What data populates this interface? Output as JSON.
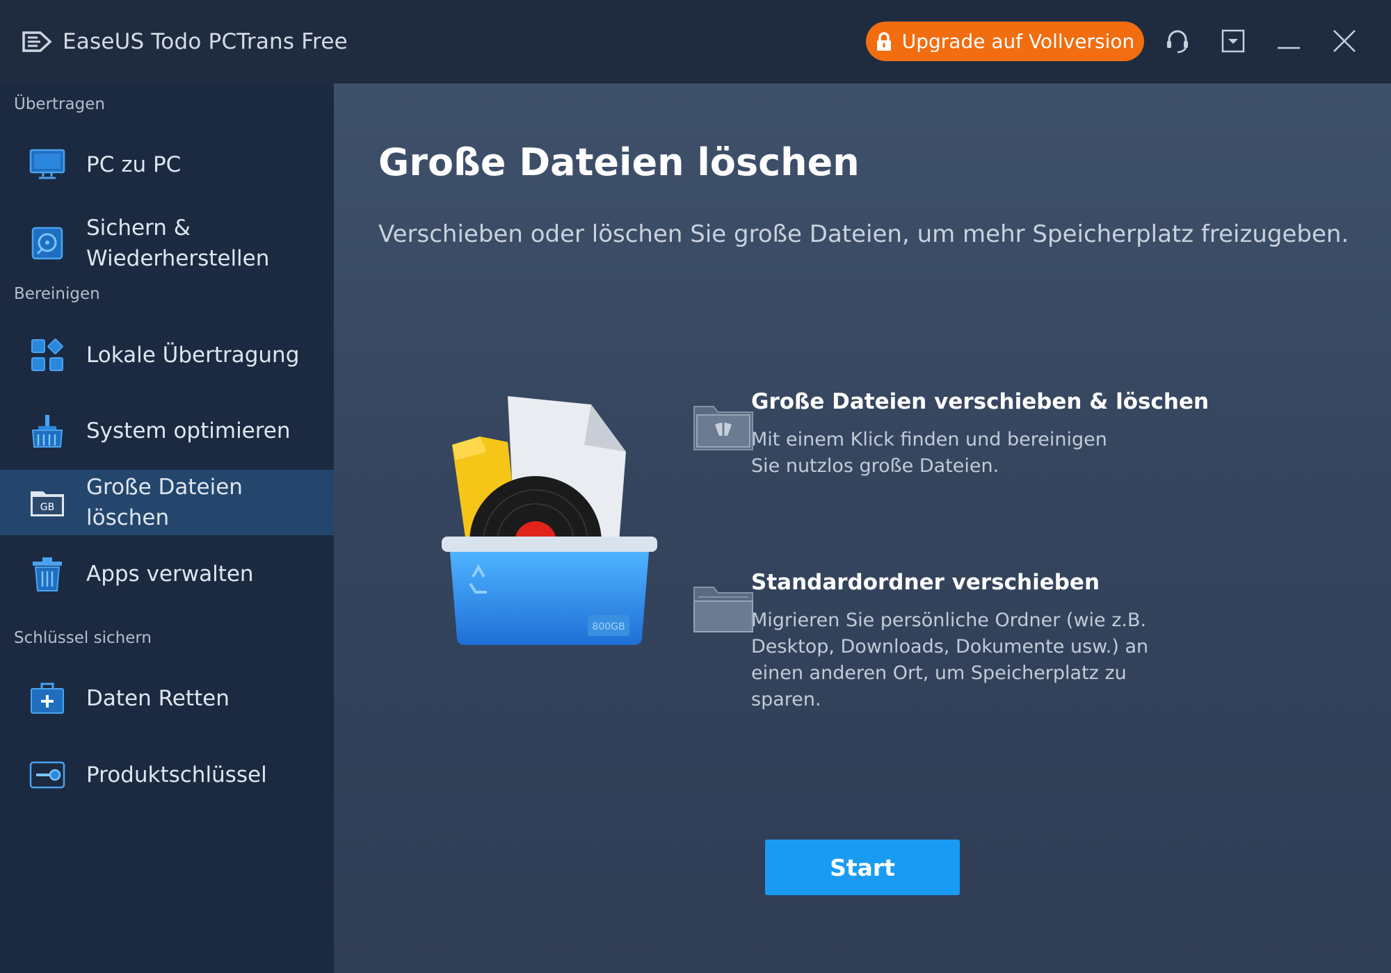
{
  "app": {
    "title": "EaseUS Todo PCTrans Free",
    "upgrade_label": "Upgrade auf Vollversion"
  },
  "sidebar": {
    "sections": [
      {
        "label": "Übertragen"
      },
      {
        "label": "Bereinigen"
      },
      {
        "label": "Schlüssel sichern"
      }
    ],
    "items": [
      {
        "label": "PC zu PC",
        "icon": "monitor-icon"
      },
      {
        "label": "Sichern & Wiederherstellen",
        "icon": "backup-disk-icon"
      },
      {
        "label": "Lokale Übertragung",
        "icon": "apps-grid-icon"
      },
      {
        "label": "System optimieren",
        "icon": "broom-icon"
      },
      {
        "label": "Große Dateien löschen",
        "icon": "gb-folder-icon",
        "active": true
      },
      {
        "label": "Apps verwalten",
        "icon": "trash-icon"
      },
      {
        "label": "Daten Retten",
        "icon": "first-aid-icon"
      },
      {
        "label": "Produktschlüssel",
        "icon": "key-icon"
      }
    ]
  },
  "main": {
    "title": "Große Dateien löschen",
    "subtitle": "Verschieben oder löschen Sie große Dateien, um mehr Speicherplatz freizugeben.",
    "illustration_badge": "800GB",
    "features": [
      {
        "title": "Große Dateien verschieben & löschen",
        "desc": "Mit einem Klick finden und bereinigen Sie nutzlos große Dateien."
      },
      {
        "title": "Standardordner verschieben",
        "desc": "Migrieren Sie persönliche Ordner (wie z.B. Desktop, Downloads, Dokumente usw.) an einen anderen Ort, um Speicherplatz zu sparen."
      }
    ],
    "start_label": "Start"
  },
  "colors": {
    "accent": "#1a9bf3",
    "upgrade": "#f26d0f",
    "sidebar_active": "#24466d"
  }
}
